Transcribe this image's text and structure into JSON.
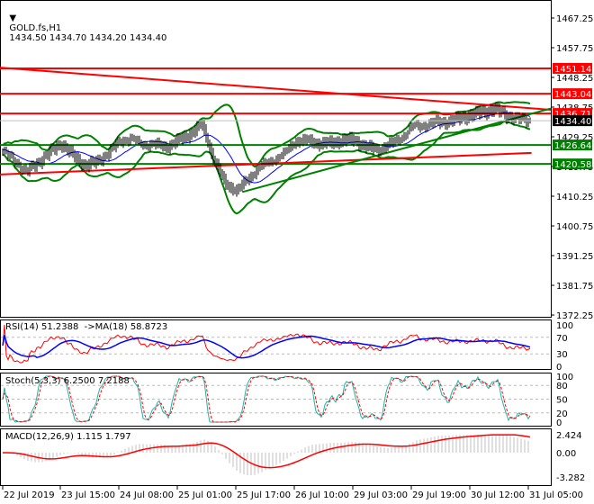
{
  "header": {
    "symbol": "GOLD.fs,H1",
    "ohlc": "1434.50 1434.70 1434.20 1434.40"
  },
  "price_axis": {
    "ticks": [
      "1467.25",
      "1457.75",
      "1448.25",
      "1438.75",
      "1429.25",
      "1419.75",
      "1410.25",
      "1400.75",
      "1391.25",
      "1381.75",
      "1372.25"
    ]
  },
  "levels": [
    {
      "value": "1451.14",
      "color": "#ff0000"
    },
    {
      "value": "1443.04",
      "color": "#ff0000"
    },
    {
      "value": "1436.71",
      "color": "#ff0000"
    },
    {
      "value": "1426.64",
      "color": "#008000"
    },
    {
      "value": "1420.58",
      "color": "#008000"
    }
  ],
  "current_price": {
    "value": "1434.40",
    "color": "#000000"
  },
  "trendlines": [
    {
      "color": "#ff0000",
      "from": [
        0,
        1451.4
      ],
      "to": [
        1,
        1437.9
      ]
    },
    {
      "color": "#ff0000",
      "from": [
        0,
        1417.2
      ],
      "to": [
        0.965,
        1424.1
      ]
    },
    {
      "color": "#008000",
      "from": [
        0.44,
        1411.6
      ],
      "to": [
        1,
        1438.3
      ]
    }
  ],
  "rsi": {
    "label": "RSI(14) 51.2388  ->MA(18) 58.8723",
    "ticks": [
      "100",
      "70",
      "30",
      "0"
    ]
  },
  "stoch": {
    "label": "Stoch(5,3,3) 6.2500 7.2188",
    "ticks": [
      "100",
      "80",
      "50",
      "20",
      "0"
    ]
  },
  "macd": {
    "label": "MACD(12,26,9) 1.115 1.797",
    "ticks": [
      "2.424",
      "0.00",
      "-3.282"
    ]
  },
  "time_axis": {
    "labels": [
      "22 Jul 2019",
      "23 Jul 15:00",
      "24 Jul 08:00",
      "25 Jul 01:00",
      "25 Jul 17:00",
      "26 Jul 10:00",
      "29 Jul 03:00",
      "29 Jul 19:00",
      "30 Jul 12:00",
      "31 Jul 05:00"
    ]
  },
  "chart_data": {
    "type": "line",
    "title": "GOLD.fs,H1",
    "closes": [
      1425,
      1422,
      1418,
      1421,
      1424,
      1427,
      1423,
      1420,
      1421,
      1424,
      1428,
      1429,
      1427,
      1427,
      1426,
      1428,
      1430,
      1433,
      1422,
      1414,
      1412,
      1416,
      1420,
      1422,
      1424,
      1428,
      1428,
      1427,
      1427,
      1428,
      1428,
      1426,
      1425,
      1427,
      1429,
      1433,
      1433,
      1434,
      1434,
      1435,
      1436,
      1437,
      1438,
      1436,
      1435,
      1434.4
    ],
    "ylim": [
      1372.25,
      1467.25
    ]
  },
  "colors": {
    "bull": "#008000",
    "bear": "#ff0000",
    "rsi": "#ff0000",
    "rsi_ma": "#0000ff",
    "stoch_main": "#20b2aa",
    "stoch_signal": "#ff0000",
    "macd_hist": "#c0c0c0",
    "macd_signal": "#ff0000"
  }
}
